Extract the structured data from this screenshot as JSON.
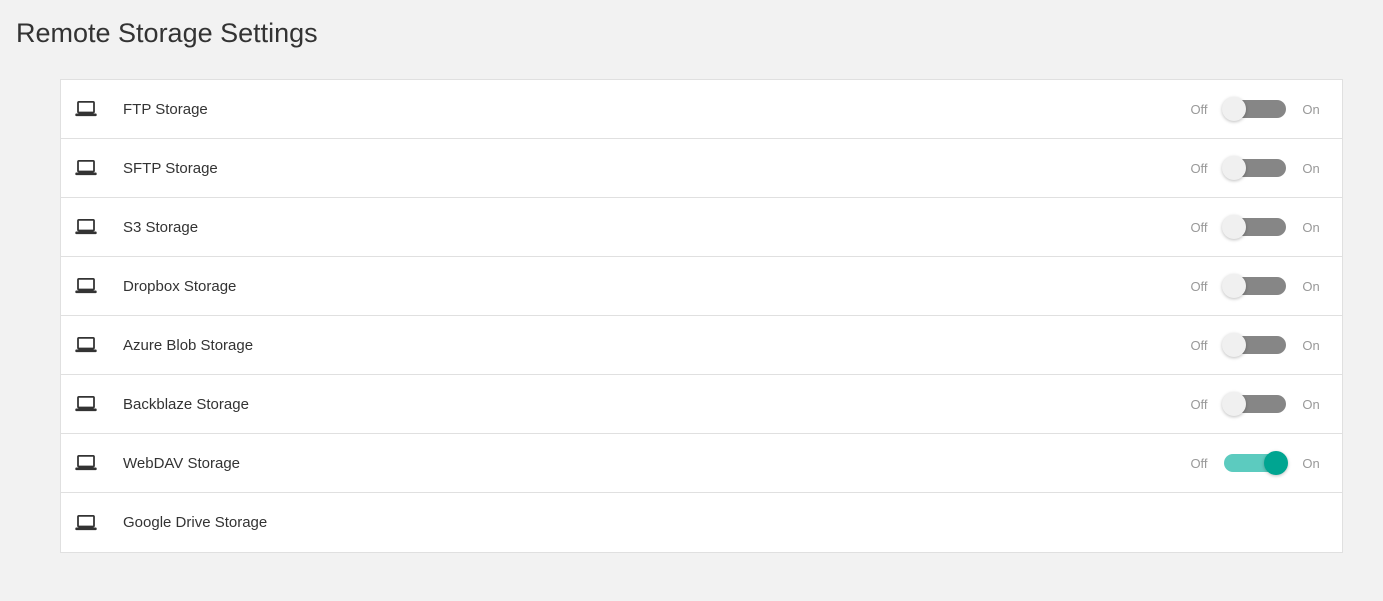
{
  "title": "Remote Storage Settings",
  "labels": {
    "off": "Off",
    "on": "On"
  },
  "items": [
    {
      "label": "FTP Storage",
      "enabled": false,
      "hasToggle": true
    },
    {
      "label": "SFTP Storage",
      "enabled": false,
      "hasToggle": true
    },
    {
      "label": "S3 Storage",
      "enabled": false,
      "hasToggle": true
    },
    {
      "label": "Dropbox Storage",
      "enabled": false,
      "hasToggle": true
    },
    {
      "label": "Azure Blob Storage",
      "enabled": false,
      "hasToggle": true
    },
    {
      "label": "Backblaze Storage",
      "enabled": false,
      "hasToggle": true
    },
    {
      "label": "WebDAV Storage",
      "enabled": true,
      "hasToggle": true
    },
    {
      "label": "Google Drive Storage",
      "enabled": false,
      "hasToggle": false
    }
  ]
}
